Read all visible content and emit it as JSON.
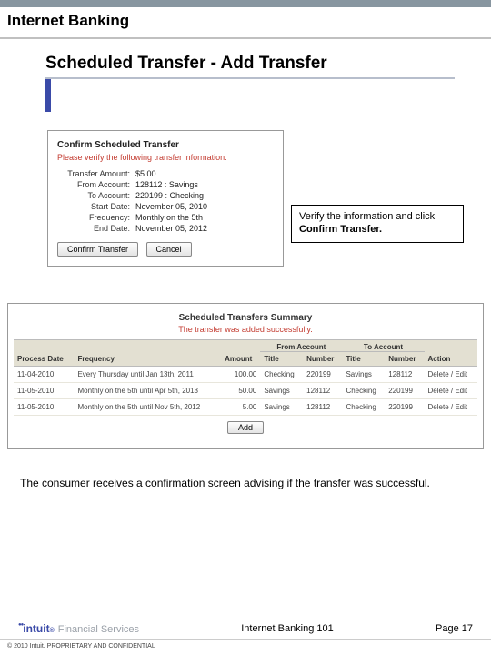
{
  "doc_title": "Internet Banking",
  "page_heading": "Scheduled Transfer - Add Transfer",
  "confirm": {
    "title": "Confirm Scheduled Transfer",
    "warn": "Please verify the following transfer information.",
    "rows": {
      "amount_k": "Transfer Amount:",
      "amount_v": "$5.00",
      "from_k": "From Account:",
      "from_v": "128112 : Savings",
      "to_k": "To Account:",
      "to_v": "220199 : Checking",
      "start_k": "Start Date:",
      "start_v": "November 05, 2010",
      "freq_k": "Frequency:",
      "freq_v": "Monthly on the 5th",
      "end_k": "End Date:",
      "end_v": "November 05, 2012"
    },
    "confirm_btn": "Confirm Transfer",
    "cancel_btn": "Cancel"
  },
  "callout": {
    "line1": "Verify the information and click",
    "line2": "Confirm Transfer."
  },
  "summary": {
    "title": "Scheduled Transfers Summary",
    "msg": "The transfer was added successfully.",
    "headers": {
      "process": "Process Date",
      "freq": "Frequency",
      "amount": "Amount",
      "from_group": "From Account",
      "to_group": "To Account",
      "title_col": "Title",
      "number_col": "Number",
      "action": "Action"
    },
    "rows": [
      {
        "date": "11-04-2010",
        "freq": "Every Thursday until Jan 13th, 2011",
        "amount": "100.00",
        "from_t": "Checking",
        "from_n": "220199",
        "to_t": "Savings",
        "to_n": "128112",
        "action": "Delete / Edit"
      },
      {
        "date": "11-05-2010",
        "freq": "Monthly on the 5th until Apr 5th, 2013",
        "amount": "50.00",
        "from_t": "Savings",
        "from_n": "128112",
        "to_t": "Checking",
        "to_n": "220199",
        "action": "Delete / Edit"
      },
      {
        "date": "11-05-2010",
        "freq": "Monthly on the 5th until Nov 5th, 2012",
        "amount": "5.00",
        "from_t": "Savings",
        "from_n": "128112",
        "to_t": "Checking",
        "to_n": "220199",
        "action": "Delete / Edit"
      }
    ],
    "add_btn": "Add"
  },
  "body_note": "The consumer receives a confirmation screen advising if the transfer was successful.",
  "footer": {
    "course": "Internet Banking 101",
    "page": "Page 17",
    "logo_main": "intuit",
    "logo_sub": "Financial Services",
    "copyright": "© 2010 Intuit. PROPRIETARY AND CONFIDENTIAL"
  }
}
